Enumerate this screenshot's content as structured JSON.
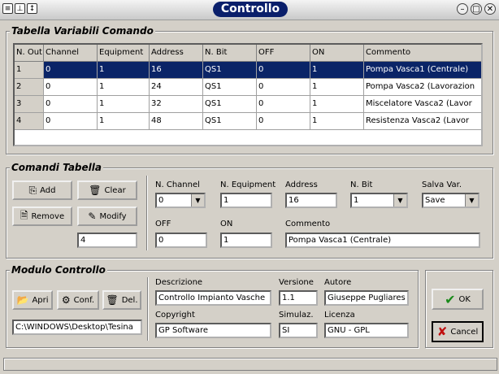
{
  "window": {
    "title": "Controllo"
  },
  "table_group": {
    "label": "Tabella Variabili Comando",
    "columns": [
      "N. Out.",
      "Channel",
      "Equipment",
      "Address",
      "N. Bit",
      "OFF",
      "ON",
      "Commento"
    ],
    "rows": [
      [
        "1",
        "0",
        "1",
        "16",
        "QS1",
        "0",
        "1",
        "Pompa Vasca1 (Centrale)"
      ],
      [
        "2",
        "0",
        "1",
        "24",
        "QS1",
        "0",
        "1",
        "Pompa Vasca2 (Lavorazion"
      ],
      [
        "3",
        "0",
        "1",
        "32",
        "QS1",
        "0",
        "1",
        "Miscelatore Vasca2 (Lavor"
      ],
      [
        "4",
        "0",
        "1",
        "48",
        "QS1",
        "0",
        "1",
        "Resistenza Vasca2 (Lavor"
      ]
    ],
    "selected_row": 0
  },
  "comandi": {
    "label": "Comandi Tabella",
    "add_label": "Add",
    "clear_label": "Clear",
    "remove_label": "Remove",
    "modify_label": "Modify",
    "count_value": "4",
    "n_channel_label": "N. Channel",
    "n_channel_value": "0",
    "n_equipment_label": "N. Equipment",
    "n_equipment_value": "1",
    "address_label": "Address",
    "address_value": "16",
    "n_bit_label": "N. Bit",
    "n_bit_value": "1",
    "salva_label": "Salva Var.",
    "salva_value": "Save",
    "off_label": "OFF",
    "off_value": "0",
    "on_label": "ON",
    "on_value": "1",
    "commento_label": "Commento",
    "commento_value": "Pompa Vasca1 (Centrale)"
  },
  "modulo": {
    "label": "Modulo Controllo",
    "apri_label": "Apri",
    "conf_label": "Conf.",
    "del_label": "Del.",
    "path_value": "C:\\WINDOWS\\Desktop\\Tesina",
    "descrizione_label": "Descrizione",
    "descrizione_value": "Controllo Impianto Vasche",
    "versione_label": "Versione",
    "versione_value": "1.1",
    "autore_label": "Autore",
    "autore_value": "Giuseppe Pugliares",
    "copyright_label": "Copyright",
    "copyright_value": "GP Software",
    "simulaz_label": "Simulaz.",
    "simulaz_value": "SI",
    "licenza_label": "Licenza",
    "licenza_value": "GNU - GPL"
  },
  "actions": {
    "ok_label": "OK",
    "cancel_label": "Cancel"
  },
  "colors": {
    "selection": "#0a2467",
    "title_pill": "#0a1f6b",
    "face": "#d4d0c8"
  }
}
